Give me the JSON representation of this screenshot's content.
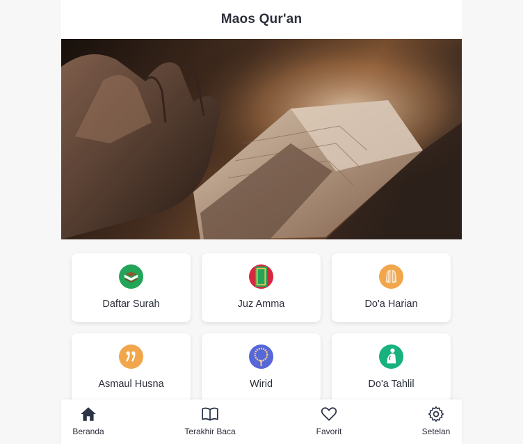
{
  "app": {
    "title": "Maos Qur'an"
  },
  "hero": {
    "image": "praying-hands-over-quran-photo"
  },
  "menu": [
    {
      "label": "Daftar Surah",
      "icon": "quran-book-icon"
    },
    {
      "label": "Juz Amma",
      "icon": "juz-amma-book-icon"
    },
    {
      "label": "Do'a Harian",
      "icon": "praying-hands-icon"
    },
    {
      "label": "Asmaul Husna",
      "icon": "asmaul-husna-icon"
    },
    {
      "label": "Wirid",
      "icon": "prayer-beads-icon"
    },
    {
      "label": "Do'a Tahlil",
      "icon": "praying-person-icon"
    }
  ],
  "nav": [
    {
      "label": "Beranda",
      "icon": "home-icon",
      "active": true
    },
    {
      "label": "Terakhir Baca",
      "icon": "open-book-icon"
    },
    {
      "label": "Favorit",
      "icon": "heart-icon"
    },
    {
      "label": "Setelan",
      "icon": "gear-icon"
    }
  ],
  "colors": {
    "text": "#2b2f3a",
    "green": "#22a559",
    "orange": "#f2a64b",
    "indigo": "#5667d8",
    "teal": "#17b27e"
  }
}
